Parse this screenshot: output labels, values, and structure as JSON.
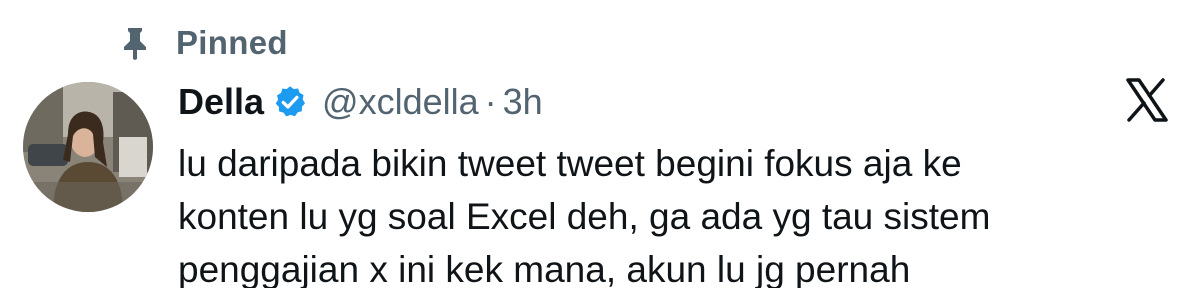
{
  "pinned": {
    "label": "Pinned",
    "icon": "pin-icon"
  },
  "author": {
    "display_name": "Della",
    "handle": "@xcldella",
    "separator": "·",
    "time": "3h",
    "verified": true,
    "verified_color": "#1d9bf0",
    "avatar_icon": "avatar"
  },
  "brand": {
    "logo": "x-logo-icon",
    "color": "#0f1419"
  },
  "tweet": {
    "lines": [
      "lu daripada bikin tweet tweet begini fokus aja ke",
      "konten lu yg soal Excel deh, ga ada yg tau sistem",
      "penggajian x ini kek mana, akun lu jg pernah"
    ]
  },
  "colors": {
    "text_primary": "#0f1419",
    "text_secondary": "#536471",
    "background": "#ffffff"
  }
}
